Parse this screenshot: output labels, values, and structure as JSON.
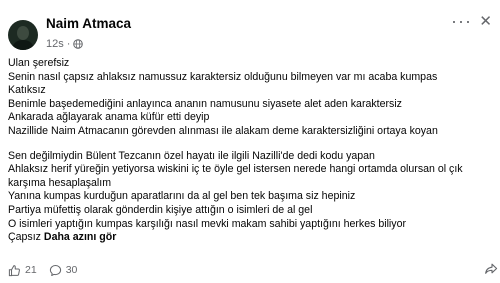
{
  "post": {
    "author": "Naim Atmaca",
    "time": "12s",
    "separator": "·",
    "paragraphs": [
      [
        "Ulan şerefsiz",
        "Senin nasıl çapsız ahlaksız namussuz karaktersiz olduğunu bilmeyen var mı acaba kumpas",
        "Katıksız",
        "Benimle başedemediğini anlayınca ananın namusunu siyasete alet aden karaktersiz",
        "Ankarada ağlayarak anama küfür etti deyip",
        "Nazillide Naim Atmacanın görevden alınması ile alakam deme karaktersizliğini ortaya koyan"
      ],
      [
        "Sen değilmiydin Bülent  Tezcanın özel hayatı ile ilgili Nazilli'de dedi kodu yapan",
        "Ahlaksız herif yüreğin yetiyorsa wiskini iç te öyle gel istersen nerede hangi ortamda olursan ol çık karşıma hesaplaşalım",
        "Yanına kumpas kurduğun aparatlarını da al gel ben tek başıma siz hepiniz",
        "Partiya müfettiş olarak gönderdin kişiye attığın o isimleri de al gel",
        "O isimleri yaptığın kumpas karşılığı nasıl mevki makam sahibi yaptığını herkes biliyor"
      ]
    ],
    "last_line_prefix": "Çapsız ",
    "last_line_bold": "Daha azını gör"
  },
  "footer": {
    "reactions_count": "21",
    "comments_count": "30"
  },
  "icons": {
    "avatar": "profile-photo",
    "globe": "globe-icon",
    "more": "more-options-icon",
    "close": "close-icon",
    "like": "like-icon",
    "comment": "comment-icon",
    "share": "share-icon"
  },
  "symbols": {
    "more": "···",
    "close": "✕"
  }
}
